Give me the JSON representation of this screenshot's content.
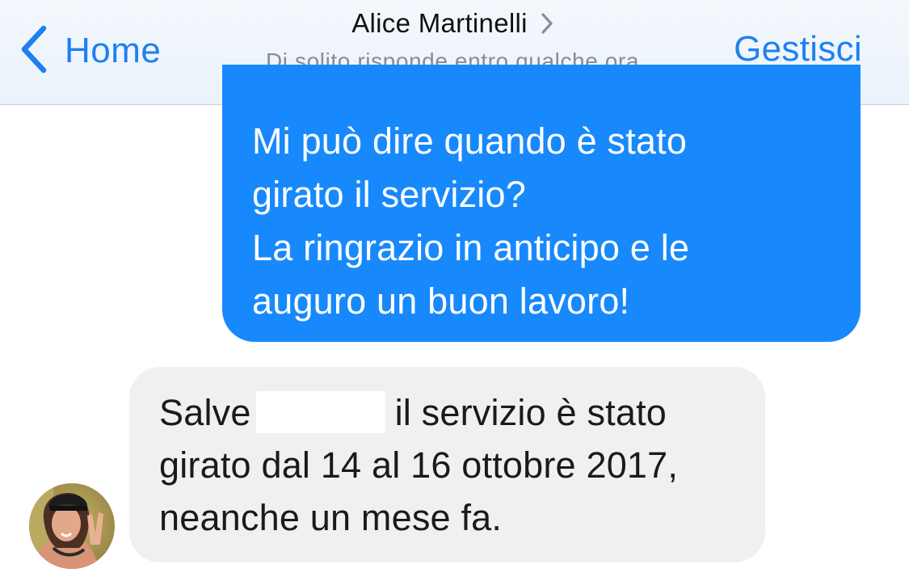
{
  "nav": {
    "back_label": "Home",
    "title": "Alice Martinelli",
    "subtitle": "Di solito risponde entro qualche ora",
    "manage_label": "Gestisci",
    "icons": {
      "back": "chevron-left-icon",
      "title_disclosure": "chevron-right-icon"
    }
  },
  "messages": [
    {
      "direction": "outgoing",
      "lines": [
        "Mi può dire quando è stato",
        "girato il servizio?",
        "La ringrazio in anticipo e le",
        "auguro un buon lavoro!"
      ]
    },
    {
      "direction": "incoming",
      "lines": [
        {
          "before": "Salve",
          "after": "il servizio è stato"
        },
        "girato dal 14 al 16 ottobre 2017,",
        "neanche un mese fa."
      ]
    }
  ],
  "colors": {
    "accent": "#1e80f0",
    "outgoing_bubble": "#1789fc",
    "incoming_bubble": "#f1f0f0",
    "header_bg": "#eef4fb"
  }
}
